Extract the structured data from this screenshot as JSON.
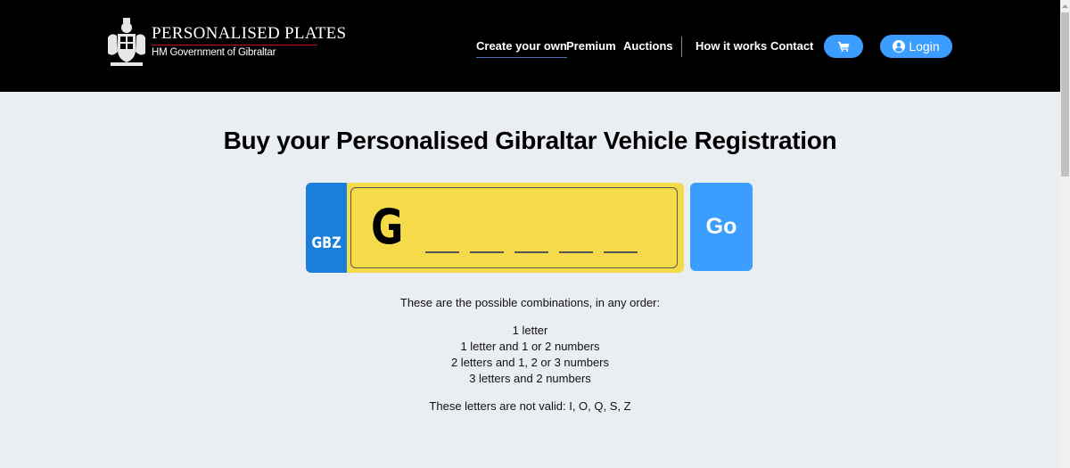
{
  "logo": {
    "title": "PERSONALISED PLATES",
    "subtitle": "HM Government of Gibraltar",
    "crest_icon": "royal-crest"
  },
  "nav": {
    "items": [
      {
        "label": "Create your own",
        "active": true
      },
      {
        "label": "Premium",
        "active": false
      },
      {
        "label": "Auctions",
        "active": false
      },
      {
        "label": "How it works",
        "active": false
      },
      {
        "label": "Contact",
        "active": false
      }
    ],
    "cart_icon": "shopping-cart",
    "login": {
      "label": "Login",
      "icon": "user-circle"
    }
  },
  "colors": {
    "header_bg": "#000000",
    "page_bg": "#eaedf2",
    "accent_blue": "#3b9eff",
    "plate_yellow": "#f5da4a",
    "plate_blue": "#1a7fdb"
  },
  "main": {
    "title": "Buy your Personalised Gibraltar Vehicle Registration",
    "plate": {
      "country_code": "GBZ",
      "prefix": "G",
      "slot_count": 5
    },
    "go_label": "Go",
    "intro": "These are the possible combinations, in any order:",
    "combinations": [
      "1 letter",
      "1 letter and 1 or 2 numbers",
      "2 letters and 1, 2 or 3 numbers",
      "3 letters and 2 numbers"
    ],
    "invalid_letters": "These letters are not valid: I, O, Q, S, Z"
  }
}
